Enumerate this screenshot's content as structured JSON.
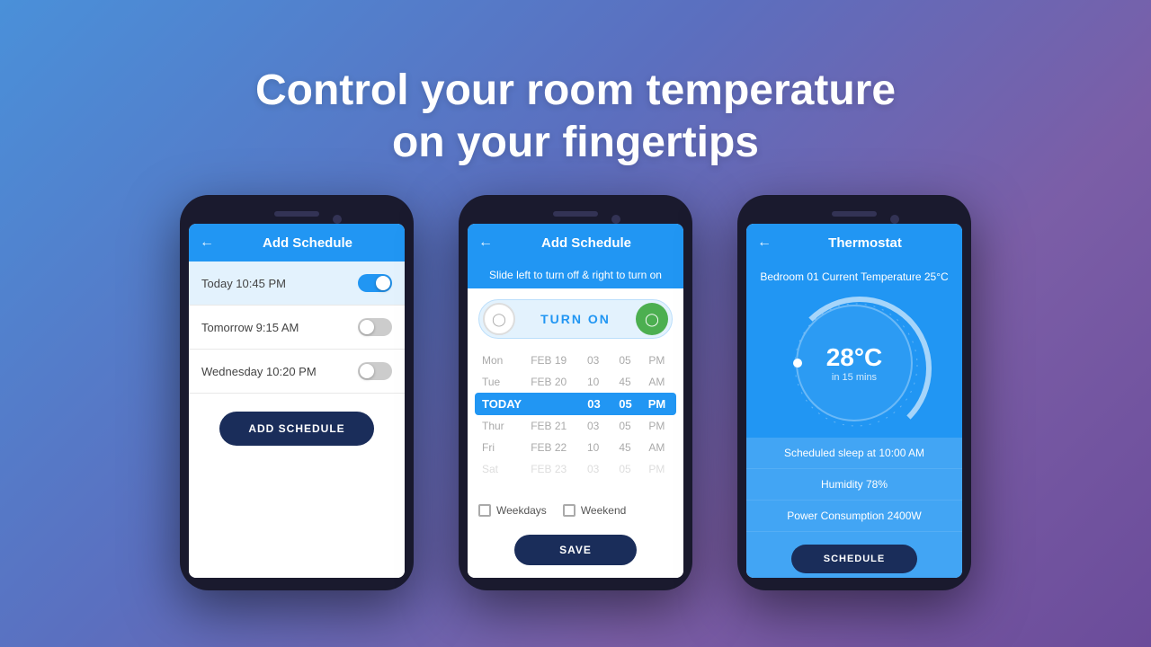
{
  "headline": {
    "line1": "Control your room temperature",
    "line2": "on your fingertips"
  },
  "phone1": {
    "header": {
      "back": "←",
      "title": "Add Schedule"
    },
    "schedules": [
      {
        "label": "Today 10:45 PM",
        "on": true
      },
      {
        "label": "Tomorrow 9:15 AM",
        "on": false
      },
      {
        "label": "Wednesday 10:20 PM",
        "on": false
      }
    ],
    "add_button": "ADD SCHEDULE"
  },
  "phone2": {
    "header": {
      "back": "←",
      "title": "Add Schedule"
    },
    "hint": "Slide left to turn off & right to turn on",
    "slider_label": "TURN ON",
    "picker": {
      "rows": [
        {
          "day": "Mon",
          "date": "FEB 19",
          "h": "03",
          "m": "05",
          "ampm": "PM",
          "selected": false
        },
        {
          "day": "Tue",
          "date": "FEB 20",
          "h": "10",
          "m": "45",
          "ampm": "AM",
          "selected": false
        },
        {
          "day": "TODAY",
          "date": "",
          "h": "03",
          "m": "05",
          "ampm": "PM",
          "selected": true
        },
        {
          "day": "Thur",
          "date": "FEB 21",
          "h": "03",
          "m": "05",
          "ampm": "PM",
          "selected": false
        },
        {
          "day": "Fri",
          "date": "FEB 22",
          "h": "10",
          "m": "45",
          "ampm": "AM",
          "selected": false
        },
        {
          "day": "Sat",
          "date": "FEB 23",
          "h": "03",
          "m": "05",
          "ampm": "PM",
          "selected": false
        }
      ]
    },
    "checkboxes": [
      "Weekdays",
      "Weekend"
    ],
    "save_button": "SAVE"
  },
  "phone3": {
    "header": {
      "back": "←",
      "title": "Thermostat"
    },
    "subtitle": "Bedroom 01 Current Temperature 25°C",
    "temp": "28°C",
    "temp_sub": "in 15 mins",
    "info": [
      "Scheduled sleep at 10:00 AM",
      "Humidity 78%",
      "Power Consumption 2400W"
    ],
    "schedule_button": "SCHEDULE"
  }
}
